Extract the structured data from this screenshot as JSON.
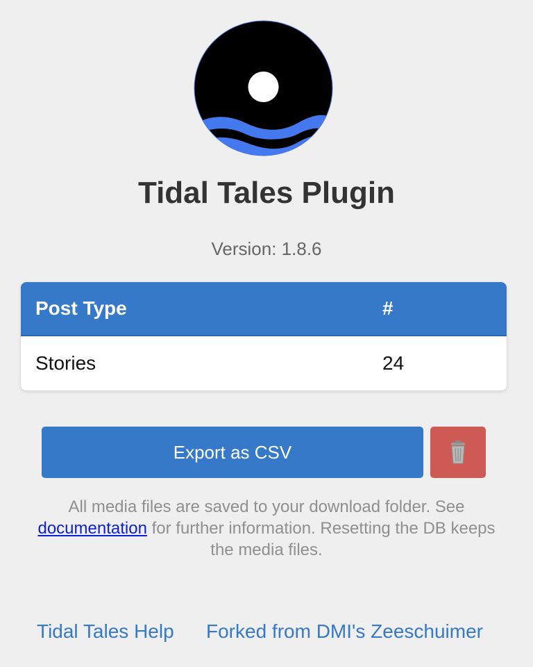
{
  "header": {
    "logo_icon": "sun-over-waves-logo-icon",
    "title": "Tidal Tales Plugin",
    "version_label": "Version: ",
    "version_value": "1.8.6"
  },
  "table": {
    "headers": [
      "Post Type",
      "#"
    ],
    "rows": [
      {
        "type": "Stories",
        "count": "24"
      }
    ]
  },
  "actions": {
    "export_label": "Export as CSV",
    "reset_icon": "trash-can-icon"
  },
  "info": {
    "text_before": "All media files are saved to your download folder. See ",
    "link_text": "documentation",
    "text_after": " for further information. Resetting the DB keeps the media files."
  },
  "footer": {
    "help_link": "Tidal Tales Help",
    "fork_link": "Forked from DMI's Zeeschuimer"
  },
  "colors": {
    "accent": "#3579c8",
    "danger": "#cd5a55",
    "background": "#efefef",
    "wave": "#4479f0"
  }
}
